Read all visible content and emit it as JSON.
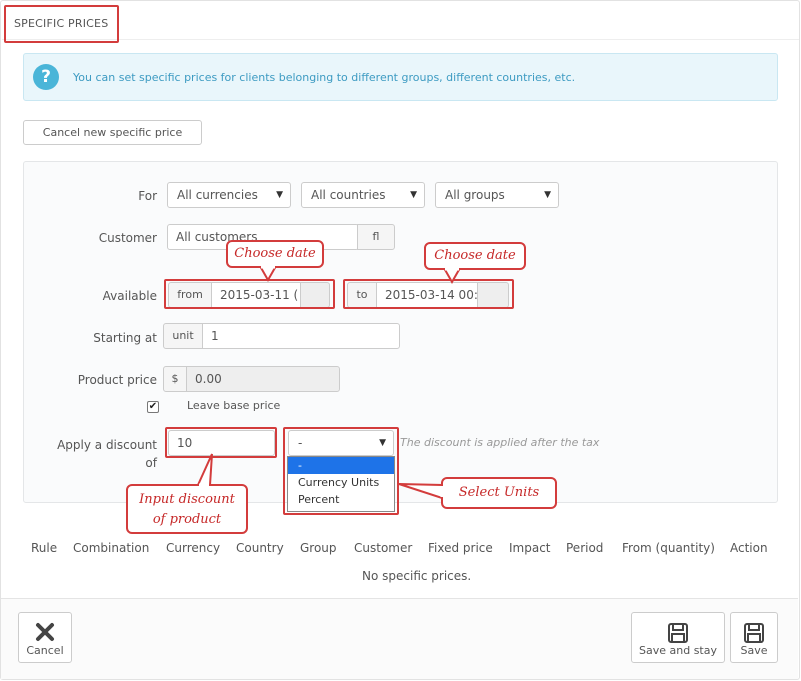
{
  "panel": {
    "title": "SPECIFIC PRICES"
  },
  "alert": {
    "icon": "question-icon",
    "icon_glyph": "?",
    "text": "You can set specific prices for clients belonging to different groups, different countries, etc."
  },
  "cancel_new_button": "Cancel new specific price",
  "form": {
    "for_label": "For",
    "currency_select": "All currencies",
    "country_select": "All countries",
    "group_select": "All groups",
    "customer_label": "Customer",
    "customer_value": "All customers",
    "customer_addon": "fl",
    "available_label": "Available",
    "from_label": "from",
    "from_value": "2015-03-11 (",
    "to_label": "to",
    "to_value": "2015-03-14 00:(",
    "starting_label": "Starting at",
    "unit_label": "unit",
    "starting_value": "1",
    "product_price_label": "Product price",
    "currency_symbol": "$",
    "product_price_value": "0.00",
    "leave_base_price_label": "Leave base price",
    "leave_base_price_checked": true,
    "discount_label_line1": "Apply a discount",
    "discount_label_line2": "of",
    "discount_value": "10",
    "reduction_type_selected": "-",
    "reduction_type_options": [
      "-",
      "Currency Units",
      "Percent"
    ],
    "discount_hint": "The discount is applied after the tax"
  },
  "callouts": {
    "choose_date_1": "Choose date",
    "choose_date_2": "Choose date",
    "input_discount_line1": "Input discount",
    "input_discount_line2": "of product",
    "select_units": "Select Units"
  },
  "table": {
    "headers": [
      "Rule",
      "Combination",
      "Currency",
      "Country",
      "Group",
      "Customer",
      "Fixed price",
      "Impact",
      "Period",
      "From (quantity)",
      "Action"
    ],
    "empty_text": "No specific prices."
  },
  "footer": {
    "cancel_label": "Cancel",
    "save_and_stay_label": "Save and stay",
    "save_label": "Save"
  },
  "colors": {
    "highlight": "#d33c3c",
    "alert_bg": "#e9f6fb",
    "alert_text": "#3d9bc2",
    "dropdown_selected": "#1e73e8"
  }
}
